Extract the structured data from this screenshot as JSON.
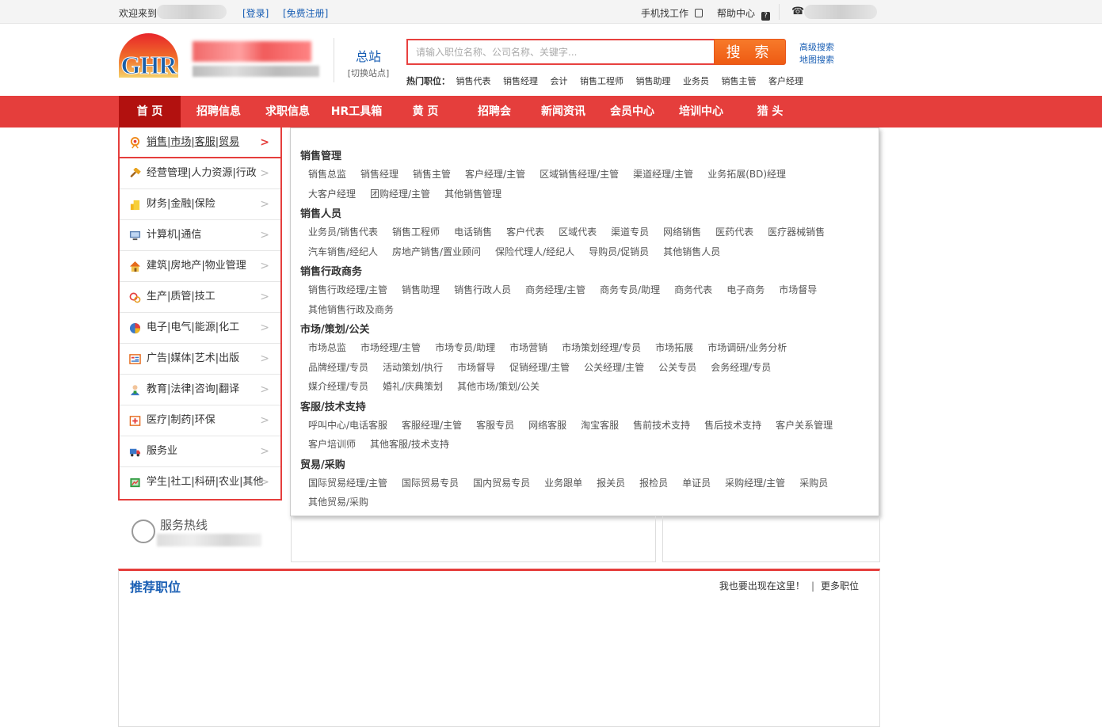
{
  "topbar": {
    "welcome": "欢迎来到",
    "login": "[登录]",
    "register": "[免费注册]",
    "mobile": "手机找工作",
    "help": "帮助中心",
    "phone_icon": "☎"
  },
  "header": {
    "logo_text": "GHR",
    "station_main": "总站",
    "station_switch": "[切换站点]",
    "search_placeholder": "请输入职位名称、公司名称、关键字...",
    "search_button": "搜 索",
    "advanced_search": "高级搜索",
    "map_search": "地图搜索",
    "hot_label": "热门职位：",
    "hot_items": [
      "销售代表",
      "销售经理",
      "会计",
      "销售工程师",
      "销售助理",
      "业务员",
      "销售主管",
      "客户经理"
    ]
  },
  "nav": {
    "items": [
      "首 页",
      "招聘信息",
      "求职信息",
      "HR工具箱",
      "黄 页",
      "招聘会",
      "新闻资讯",
      "会员中心",
      "培训中心",
      "猎 头"
    ]
  },
  "categories": [
    {
      "label": "销售|市场|客服|贸易",
      "icon": "sales-icon"
    },
    {
      "label": "经营管理|人力资源|行政",
      "icon": "hammer-icon"
    },
    {
      "label": "财务|金融|保险",
      "icon": "coins-icon"
    },
    {
      "label": "计算机|通信",
      "icon": "monitor-icon"
    },
    {
      "label": "建筑|房地产|物业管理",
      "icon": "house-icon"
    },
    {
      "label": "生产|质管|技工",
      "icon": "gear-icon"
    },
    {
      "label": "电子|电气|能源|化工",
      "icon": "pie-icon"
    },
    {
      "label": "广告|媒体|艺术|出版",
      "icon": "media-icon"
    },
    {
      "label": "教育|法律|咨询|翻译",
      "icon": "teacher-icon"
    },
    {
      "label": "医疗|制药|环保",
      "icon": "medical-icon"
    },
    {
      "label": "服务业",
      "icon": "truck-icon"
    },
    {
      "label": "学生|社工|科研|农业|其他",
      "icon": "book-icon"
    }
  ],
  "panel": {
    "groups": [
      {
        "title": "销售管理",
        "items": [
          "销售总监",
          "销售经理",
          "销售主管",
          "客户经理/主管",
          "区域销售经理/主管",
          "渠道经理/主管",
          "业务拓展(BD)经理",
          "大客户经理",
          "团购经理/主管",
          "其他销售管理"
        ]
      },
      {
        "title": "销售人员",
        "items": [
          "业务员/销售代表",
          "销售工程师",
          "电话销售",
          "客户代表",
          "区域代表",
          "渠道专员",
          "网络销售",
          "医药代表",
          "医疗器械销售",
          "汽车销售/经纪人",
          "房地产销售/置业顾问",
          "保险代理人/经纪人",
          "导购员/促销员",
          "其他销售人员"
        ]
      },
      {
        "title": "销售行政商务",
        "items": [
          "销售行政经理/主管",
          "销售助理",
          "销售行政人员",
          "商务经理/主管",
          "商务专员/助理",
          "商务代表",
          "电子商务",
          "市场督导",
          "其他销售行政及商务"
        ]
      },
      {
        "title": "市场/策划/公关",
        "items": [
          "市场总监",
          "市场经理/主管",
          "市场专员/助理",
          "市场营销",
          "市场策划经理/专员",
          "市场拓展",
          "市场调研/业务分析",
          "品牌经理/专员",
          "活动策划/执行",
          "市场督导",
          "促销经理/主管",
          "公关经理/主管",
          "公关专员",
          "会务经理/专员",
          "媒介经理/专员",
          "婚礼/庆典策划",
          "其他市场/策划/公关"
        ]
      },
      {
        "title": "客服/技术支持",
        "items": [
          "呼叫中心/电话客服",
          "客服经理/主管",
          "客服专员",
          "网络客服",
          "淘宝客服",
          "售前技术支持",
          "售后技术支持",
          "客户关系管理",
          "客户培训师",
          "其他客服/技术支持"
        ]
      },
      {
        "title": "贸易/采购",
        "items": [
          "国际贸易经理/主管",
          "国际贸易专员",
          "国内贸易专员",
          "业务跟单",
          "报关员",
          "报检员",
          "单证员",
          "采购经理/主管",
          "采购员",
          "其他贸易/采购"
        ]
      }
    ]
  },
  "hotline": {
    "title": "服务热线"
  },
  "recommend": {
    "title": "推荐职位",
    "appear_link": "我也要出现在这里！",
    "divider": "|",
    "more_link": "更多职位"
  }
}
